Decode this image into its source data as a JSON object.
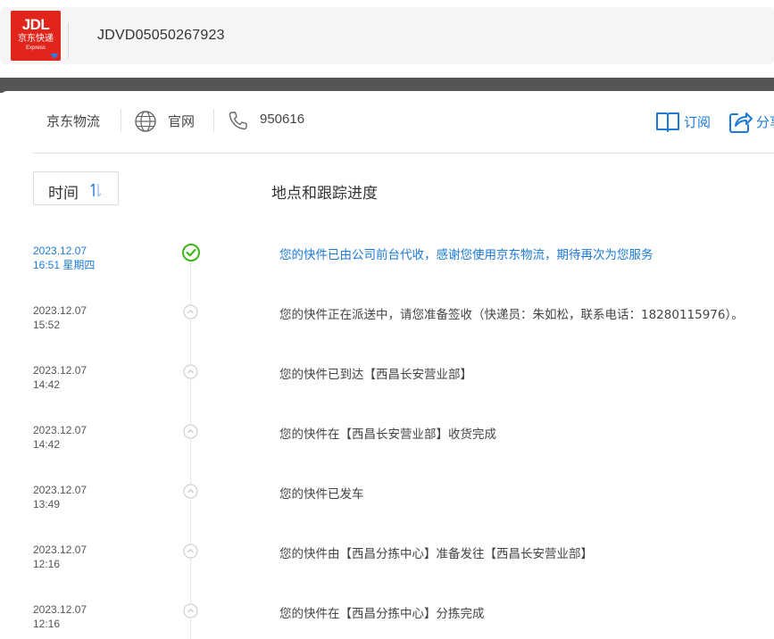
{
  "header": {
    "logo": {
      "brand": "JDL",
      "name": "京东快递",
      "sub": "Express"
    },
    "tracking_number": "JDVD05050267923"
  },
  "info": {
    "company": "京东物流",
    "website_label": "官网",
    "phone": "950616",
    "subscribe_label": "订阅",
    "share_label": "分享"
  },
  "columns": {
    "time": "时间",
    "progress": "地点和跟踪进度"
  },
  "colors": {
    "accent": "#1d7bd8",
    "brand": "#e1251b",
    "success": "#3fb618"
  },
  "events": [
    {
      "date": "2023.12.07",
      "time": "16:51 星期四",
      "text": "您的快件已由公司前台代收，感谢您使用京东物流，期待再次为您服务",
      "active": true
    },
    {
      "date": "2023.12.07",
      "time": "15:52",
      "text": "您的快件正在派送中，请您准备签收（快递员：朱如松，联系电话：18280115976）。",
      "active": false
    },
    {
      "date": "2023.12.07",
      "time": "14:42",
      "text": "您的快件已到达【西昌长安营业部】",
      "active": false
    },
    {
      "date": "2023.12.07",
      "time": "14:42",
      "text": "您的快件在【西昌长安营业部】收货完成",
      "active": false
    },
    {
      "date": "2023.12.07",
      "time": "13:49",
      "text": "您的快件已发车",
      "active": false
    },
    {
      "date": "2023.12.07",
      "time": "12:16",
      "text": "您的快件由【西昌分拣中心】准备发往【西昌长安营业部】",
      "active": false
    },
    {
      "date": "2023.12.07",
      "time": "12:16",
      "text": "您的快件在【西昌分拣中心】分拣完成",
      "active": false
    }
  ]
}
